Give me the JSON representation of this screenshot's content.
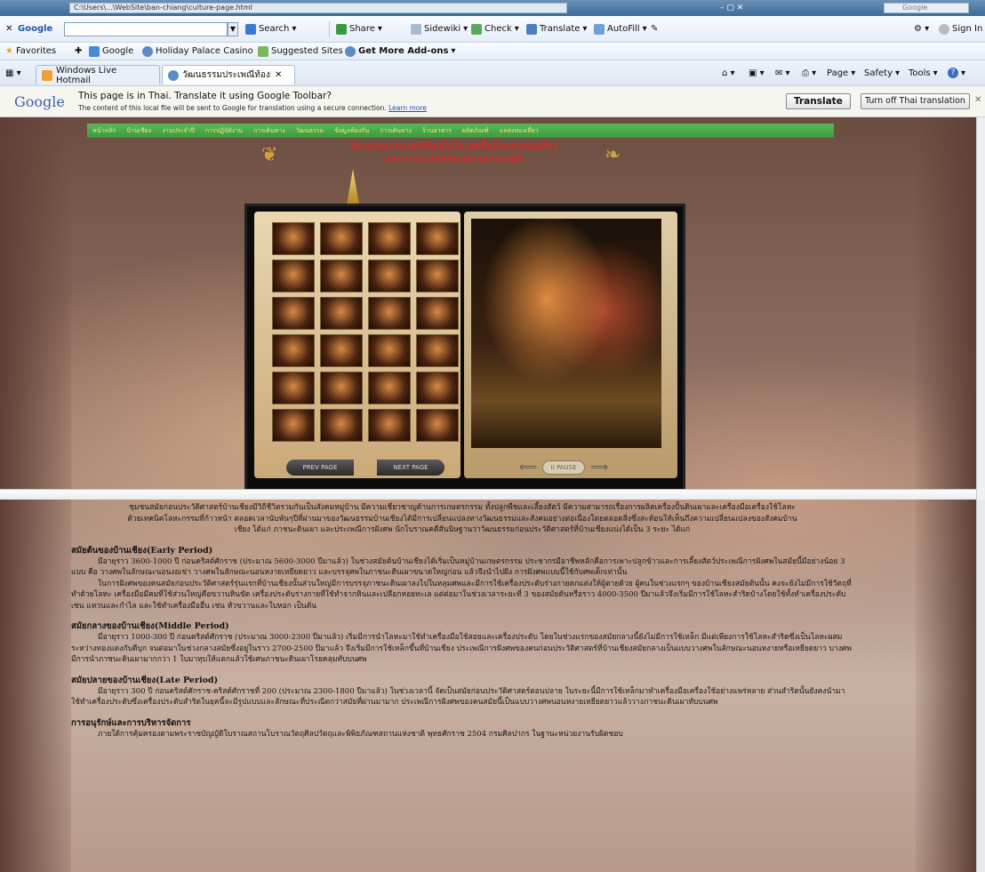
{
  "browser": {
    "address_text": "C:\\Users\\...\\WebSite\\ban-chiang\\culture-page.html",
    "search_placeholder": "Google",
    "window_controls": "–  ▢  ✕"
  },
  "google_toolbar": {
    "label": "Google",
    "items": [
      "Search",
      "Share",
      "Sidewiki",
      "Check",
      "Translate",
      "AutoFill"
    ],
    "sign_in": "Sign In"
  },
  "favorites_bar": {
    "favorites": "Favorites",
    "links": [
      "Google",
      "Holiday Palace Casino",
      "Suggested Sites",
      "Get More Add-ons"
    ]
  },
  "tabs": {
    "items": [
      {
        "label": "Windows Live Hotmail"
      },
      {
        "label": "วัฒนธรรมประเพณีท้องถิ่น..."
      }
    ],
    "commands": [
      "Page",
      "Safety",
      "Tools"
    ]
  },
  "translate_bar": {
    "brand": "Google",
    "headline": "This page is in Thai.  Translate it using Google Toolbar?",
    "subtext": "The content of this local file will be sent to Google for translation using a secure connection.",
    "learn_more": "Learn more",
    "translate_button": "Translate",
    "turn_off_button": "Turn off Thai translation"
  },
  "site": {
    "nav_items": [
      "หน้าหลัก",
      "บ้านเชียง",
      "งานประจำปี",
      "การปฏิบัติงาน",
      "การเดินทาง",
      "วัฒนธรรม",
      "ข้อมูลท้องถิ่น",
      "การเดินทาง",
      "ร้านอาหาร",
      "ผลิตภัณฑ์",
      "แหล่งท่องเที่ยว"
    ],
    "title_line1": "วัฒนธรรมประเพณีท้องถิ่นในเขตพื้นที่แหล่งท่องเที่ยว",
    "title_line2": "และการอนุรักษ์วัฒนธรรมประเพณี",
    "gallery": {
      "prev_label": "PREV PAGE",
      "next_label": "NEXT PAGE",
      "pause_label": "II PAUSE"
    }
  },
  "article": {
    "intro": "ชุมชนสมัยก่อนประวัติศาสตร์บ้านเชียงมีวิถีชีวิตรวมกันเป็นสังคมหมู่บ้าน มีความเชี่ยวชาญด้านการเกษตรกรรม ทั้งปลูกพืชและเลี้ยงสัตว์ มีความสามารถเรื่องการผลิตเครื่องปั้นดินเผาและเครื่องมือเครื่องใช้โลหะด้วยเทคนิคโลหะกรรมที่ก้าวหน้า ตลอดเวลานับพันๆปีที่ผ่านมาของวัฒนธรรมบ้านเชียงได้มีการเปลี่ยนแปลงทางวัฒนธรรมและสังคมอย่างต่อเนื่องโดยตลอดสิ่งซึ่งสะท้อนให้เห็นถึงความเปลี่ยนแปลงของสังคมบ้านเชียง ได้แก่ ภาชนะดินเผา และประเพณีการฝังศพ นักโบราณคดีสันนิษฐานว่าวัฒนธรรมก่อนประวัติศาสตร์ที่บ้านเชียงแบ่งได้เป็น 3 ระยะ ได้แก่",
    "sections": [
      {
        "heading": "สมัยต้นของบ้านเชียง(Early Period)",
        "paras": [
          "มีอายุราว 3600-1000 ปี ก่อนคริสต์ศักราช (ประมาณ 5600-3000 ปีมาแล้ว) ในช่วงสมัยต้นบ้านเชียงได้เริ่มเป็นหมู่บ้านเกษตรกรรม ประชากรมีอาชีพหลักคือการเพาะปลูกข้าวและการเลี้ยงสัตว์ประเพณีการฝังศพในสมัยนี้มีอย่างน้อย 3 แบบ คือ วางศพในลักษณะนอนงอเข่า วางศพในลักษณะนอนหงายเหยียดยาว และบรรจุศพในภาชนะดินเผาขนาดใหญ่ก่อน แล้วจึงนำไปฝัง การฝังศพแบบนี้ใช้กับศพเด็กเท่านั้น",
          "ในการฝังศพของคนสมัยก่อนประวัติศาสตร์รุ่นแรกที่บ้านเชียงนั้นส่วนใหญ่มีการบรรจุภาชนะดินเผาลงไปในหลุมศพและมีการใช้เครื่องประดับร่างกายตกแต่งให้ผู้ตายด้วย ผู้คนในช่วงแรกๆ ของบ้านเชียงสมัยต้นนั้น คงจะยังไม่มีการใช้วัตถุที่ทำด้วยโลหะ เครื่องมือมีคมที่ใช้ส่วนใหญ่คือขวานหินขัด เครื่องประดับร่างกายที่ใช้ทำจากหินและเปลือกหอยทะเล แต่ต่อมาในช่วงเวลาระยะที่ 3 ของสมัยต้นหรือราว 4000-3500 ปีมาแล้วจึงเริ่มมีการใช้โลหะสำริดบ้างโดยใช้ทั้งทำเครื่องประดับ เช่น แหวนและกำไล และใช้ทำเครื่องมืออื่น เช่น หัวขวานและใบหอก เป็นต้น"
        ]
      },
      {
        "heading": "สมัยกลางของบ้านเชียง(Middle Period)",
        "paras": [
          "มีอายุราว 1000-300 ปี ก่อนคริสต์ศักราช (ประมาณ 3000-2300 ปีมาแล้ว) เริ่มมีการนำโลหะมาใช้ทำเครื่องมือใช้สอยและเครื่องประดับ โดยในช่วงแรกของสมัยกลางนี้ยังไม่มีการใช้เหล็ก มีแต่เพียงการใช้โลหะสำริดซึ่งเป็นโลหะผสมระหว่างทองแดงกับดีบุก จนต่อมาในช่วงกลางสมัยซึ่งอยู่ในราว 2700-2500 ปีมาแล้ว จึงเริ่มมีการใช้เหล็กขึ้นที่บ้านเชียง ประเพณีการฝังศพของคนก่อนประวัติศาสตร์ที่บ้านเชียงสมัยกลางเป็นแบบวางศพในลักษณะนอนหงายหรือเหยียดยาว บางศพมีการนำภาชนะดินเผามากกว่า 1 ใบมาทุบให้แตกแล้วใช้เศษภาชนะดินเผาโรยคลุมทับบนศพ"
        ]
      },
      {
        "heading": "สมัยปลายของบ้านเชียง(Late Period)",
        "paras": [
          "มีอายุราว 300 ปี ก่อนคริสต์ศักราช-คริสต์ศักราชที่ 200 (ประมาณ 2300-1800 ปีมาแล้ว) ในช่วงเวลานี้ จัดเป็นสมัยก่อนประวัติศาสตร์ตอนปลาย ในระยะนี้มีการใช้เหล็กมาทำเครื่องมือเครื่องใช้อย่างแพร่หลาย ส่วนสำริดนั้นยังคงนำมาใช้ทำเครื่องประดับซึ่งเครื่องประดับสำริดในยุคนี้จะมีรูปแบบและลักษณะที่ประณีตกว่าสมัยที่ผ่านมามาก ประเพณีการฝังศพของคนสมัยนี้เป็นแบบวางศพนอนหงายเหยียดยาวแล้ววางภาชนะดินเผาทับบนศพ"
        ]
      },
      {
        "heading": "การอนุรักษ์และการบริหารจัดการ",
        "paras": [
          "ภายใต้การคุ้มครองตามพระราชบัญญัติโบราณสถานโบราณวัตถุศิลปวัตถุและพิพิธภัณฑสถานแห่งชาติ พุทธศักราช 2504 กรมศิลปากร ในฐานะหน่วยงานรับผิดชอบ"
        ]
      }
    ]
  },
  "colors": {
    "nav_bg": "#3fa341",
    "nav_text": "#ffe27a",
    "title_red": "#c9302c",
    "gold": "#d4a23c"
  }
}
